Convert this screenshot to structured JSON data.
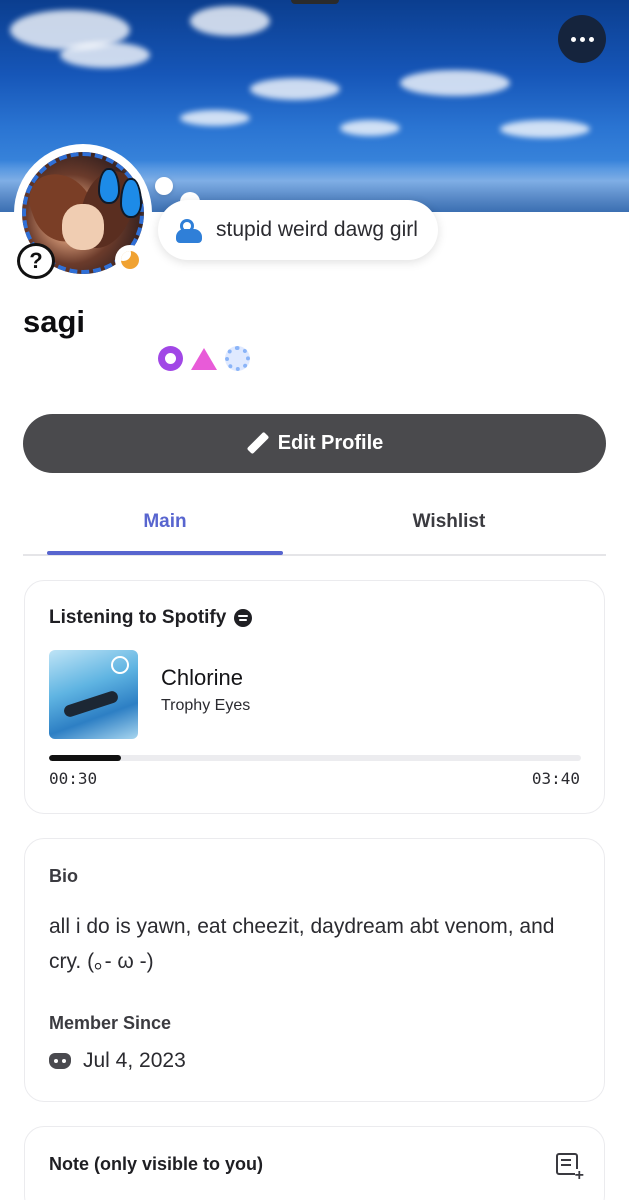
{
  "profile": {
    "username": "sagi",
    "status_text": "stupid weird dawg girl",
    "help_glyph": "?",
    "badges": [
      "nitro-icon",
      "hypesquad-triangle-icon",
      "laurel-icon"
    ]
  },
  "actions": {
    "edit_profile_label": "Edit Profile",
    "more_icon": "more-horizontal-icon"
  },
  "tabs": [
    {
      "label": "Main",
      "active": true
    },
    {
      "label": "Wishlist",
      "active": false
    }
  ],
  "spotify": {
    "header": "Listening to Spotify",
    "track": "Chlorine",
    "artist": "Trophy Eyes",
    "elapsed": "00:30",
    "duration": "03:40",
    "progress_fraction": 0.136
  },
  "bio": {
    "label": "Bio",
    "text": "all i do is yawn, eat cheezit, daydream abt venom, and cry. (｡- ω -)",
    "member_since_label": "Member Since",
    "member_since": "Jul 4, 2023"
  },
  "note": {
    "title": "Note (only visible to you)"
  },
  "colors": {
    "accent": "#5865cf",
    "button_bg": "#4a4a4d",
    "idle_status": "#f0a232"
  }
}
